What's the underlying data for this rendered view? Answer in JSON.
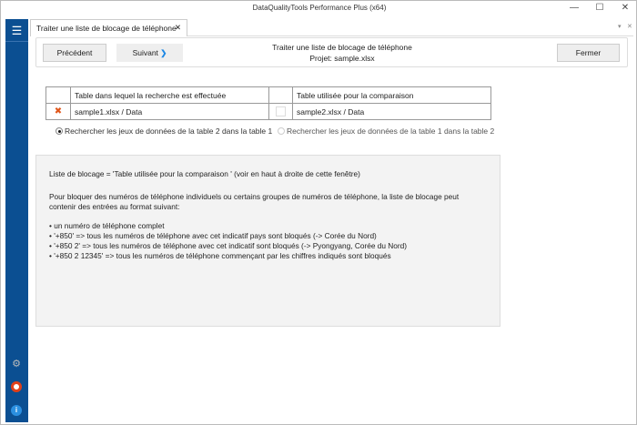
{
  "window": {
    "title": "DataQualityTools Performance Plus (x64)",
    "minimize": "—",
    "maximize": "☐",
    "close": "✕"
  },
  "sidebar": {
    "menu_icon": "hamburger-icon",
    "bottom_icons": [
      "gear-icon",
      "lifebuoy-icon",
      "info-icon"
    ],
    "color": "#0b4f92"
  },
  "tab": {
    "label": "Traiter une liste de blocage de téléphone",
    "close": "✕",
    "tabstrip_menu": "▾",
    "tabstrip_close": "✕"
  },
  "header": {
    "prev_label": "Précédent",
    "next_label": "Suivant",
    "next_chevron": "❯",
    "title": "Traiter une liste de blocage de téléphone",
    "project": "Projet: sample.xlsx",
    "close_label": "Fermer"
  },
  "table": {
    "col1_header": "Table dans lequel la recherche est effectuée",
    "col2_header": "Table utilisée pour la comparaison",
    "row1_icon": "✖",
    "col1_value": "sample1.xlsx / Data",
    "col2_value": "sample2.xlsx / Data"
  },
  "options": {
    "opt1": "Rechercher les jeux de données de la table 2 dans la table 1",
    "opt2": "Rechercher les jeux de données de la table 1 dans la table 2",
    "selected": "opt1"
  },
  "info": {
    "line1": "Liste de blocage = 'Table utilisée pour la comparaison ' (voir en haut à droite de cette fenêtre)",
    "para": "Pour bloquer des numéros de téléphone individuels ou certains groupes de numéros de téléphone, la liste de blocage peut contenir des entrées au format suivant:",
    "bullets": [
      "• un numéro de téléphone complet",
      "• '+850' => tous les numéros de téléphone avec cet indicatif pays sont bloqués (-> Corée du Nord)",
      "• '+850 2' => tous les numéros de téléphone avec cet indicatif sont bloqués (-> Pyongyang, Corée du Nord)",
      "• '+850 2 12345' => tous les numéros de téléphone commençant par les chiffres indiqués sont bloqués"
    ]
  }
}
